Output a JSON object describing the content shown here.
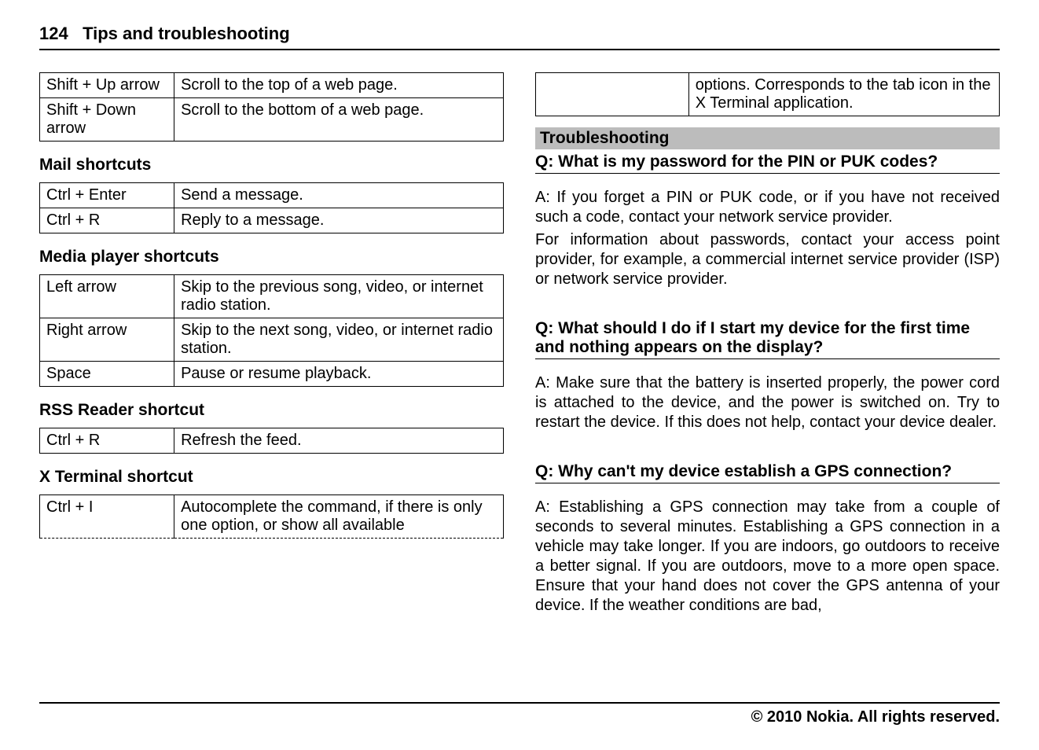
{
  "header": {
    "page_number": "124",
    "title": "Tips and troubleshooting"
  },
  "left": {
    "web_shortcuts": [
      {
        "key": "Shift + Up arrow",
        "desc": "Scroll to the top of a web page."
      },
      {
        "key": "Shift + Down arrow",
        "desc": "Scroll to the bottom of a web page."
      }
    ],
    "mail_heading": "Mail shortcuts",
    "mail_shortcuts": [
      {
        "key": "Ctrl + Enter",
        "desc": "Send a message."
      },
      {
        "key": "Ctrl + R",
        "desc": "Reply to a message."
      }
    ],
    "media_heading": "Media player shortcuts",
    "media_shortcuts": [
      {
        "key": "Left arrow",
        "desc": "Skip to the previous song, video, or internet radio station."
      },
      {
        "key": "Right arrow",
        "desc": "Skip to the next song, video, or internet radio station."
      },
      {
        "key": "Space",
        "desc": "Pause or resume playback."
      }
    ],
    "rss_heading": "RSS Reader shortcut",
    "rss_shortcuts": [
      {
        "key": "Ctrl + R",
        "desc": "Refresh the feed."
      }
    ],
    "xterm_heading": "X Terminal shortcut",
    "xterm_shortcuts": [
      {
        "key": "Ctrl + I",
        "desc": "Autocomplete the command, if there is only one option, or show all available"
      }
    ]
  },
  "right": {
    "cont_row": {
      "blank": "",
      "desc": "options. Corresponds to the tab icon in the X Terminal application."
    },
    "troubleshooting_bar": "Troubleshooting",
    "q1": "Q: What is my password for the PIN or PUK codes?",
    "a1_p1": "A: If you forget a PIN or PUK code, or if you have not received such a code, contact your network service provider.",
    "a1_p2": "For information about passwords, contact your access point provider, for example, a commercial internet service provider (ISP) or network service provider.",
    "q2": "Q: What should I do if I start my device for the first time and nothing appears on the display?",
    "a2": "A: Make sure that the battery is inserted properly, the power cord is attached to the device, and the power is switched on. Try to restart the device. If this does not help, contact your device dealer.",
    "q3": "Q: Why can't my device establish a GPS connection?",
    "a3": "A: Establishing a GPS connection may take from a couple of seconds to several minutes. Establishing a GPS connection in a vehicle may take longer. If you are indoors, go outdoors to receive a better signal. If you are outdoors, move to a more open space. Ensure that your hand does not cover the GPS antenna of your device. If the weather conditions are bad,"
  },
  "footer": "© 2010 Nokia. All rights reserved."
}
